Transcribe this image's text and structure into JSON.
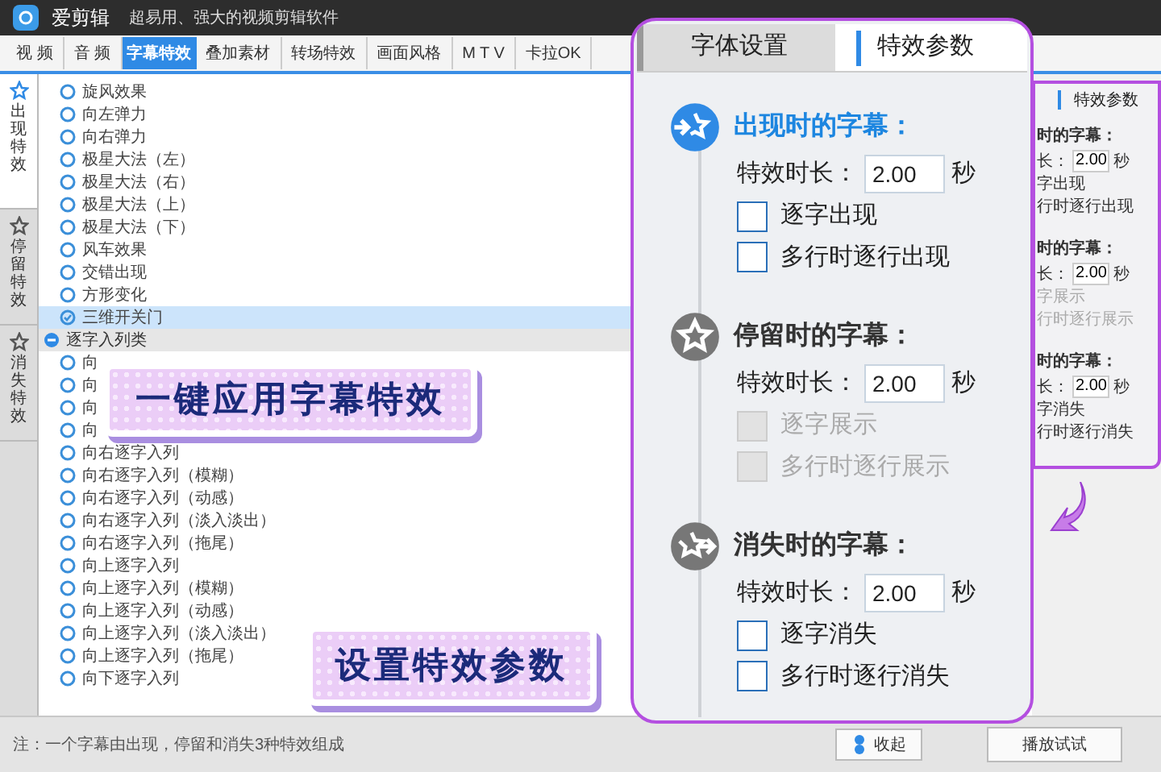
{
  "title_bar": {
    "app_name": "爱剪辑",
    "slogan": "超易用、强大的视频剪辑软件"
  },
  "tabs": [
    {
      "label": "视 频",
      "selected": false
    },
    {
      "label": "音 频",
      "selected": false
    },
    {
      "label": "字幕特效",
      "selected": true
    },
    {
      "label": "叠加素材",
      "selected": false
    },
    {
      "label": "转场特效",
      "selected": false
    },
    {
      "label": "画面风格",
      "selected": false
    },
    {
      "label": "M T V",
      "selected": false
    },
    {
      "label": "卡拉OK",
      "selected": false
    }
  ],
  "side_tabs": [
    {
      "label": "出现特效",
      "selected": true
    },
    {
      "label": "停留特效",
      "selected": false
    },
    {
      "label": "消失特效",
      "selected": false
    }
  ],
  "effect_list": [
    {
      "kind": "item",
      "label": "旋风效果",
      "selected": false
    },
    {
      "kind": "item",
      "label": "向左弹力",
      "selected": false
    },
    {
      "kind": "item",
      "label": "向右弹力",
      "selected": false
    },
    {
      "kind": "item",
      "label": "极星大法（左）",
      "selected": false
    },
    {
      "kind": "item",
      "label": "极星大法（右）",
      "selected": false
    },
    {
      "kind": "item",
      "label": "极星大法（上）",
      "selected": false
    },
    {
      "kind": "item",
      "label": "极星大法（下）",
      "selected": false
    },
    {
      "kind": "item",
      "label": "风车效果",
      "selected": false
    },
    {
      "kind": "item",
      "label": "交错出现",
      "selected": false
    },
    {
      "kind": "item",
      "label": "方形变化",
      "selected": false
    },
    {
      "kind": "item",
      "label": "三维开关门",
      "selected": true
    },
    {
      "kind": "category",
      "label": "逐字入列类",
      "expanded": true,
      "children": [
        {
          "kind": "item",
          "label": "向",
          "selected": false
        },
        {
          "kind": "item",
          "label": "向",
          "selected": false
        },
        {
          "kind": "item",
          "label": "向",
          "selected": false
        },
        {
          "kind": "item",
          "label": "向",
          "selected": false
        },
        {
          "kind": "item",
          "label": "向右逐字入列",
          "selected": false
        },
        {
          "kind": "item",
          "label": "向右逐字入列（模糊）",
          "selected": false
        },
        {
          "kind": "item",
          "label": "向右逐字入列（动感）",
          "selected": false
        },
        {
          "kind": "item",
          "label": "向右逐字入列（淡入淡出）",
          "selected": false
        },
        {
          "kind": "item",
          "label": "向右逐字入列（拖尾）",
          "selected": false
        },
        {
          "kind": "item",
          "label": "向上逐字入列",
          "selected": false
        },
        {
          "kind": "item",
          "label": "向上逐字入列（模糊）",
          "selected": false
        },
        {
          "kind": "item",
          "label": "向上逐字入列（动感）",
          "selected": false
        },
        {
          "kind": "item",
          "label": "向上逐字入列（淡入淡出）",
          "selected": false
        },
        {
          "kind": "item",
          "label": "向上逐字入列（拖尾）",
          "selected": false
        },
        {
          "kind": "item",
          "label": "向下逐字入列",
          "selected": false
        }
      ]
    }
  ],
  "background_panel": {
    "tab": "特效参数",
    "sections": [
      {
        "title": "时的字幕：",
        "duration_label": "长：",
        "duration_value": "2.00",
        "unit": "秒",
        "options": [
          {
            "label": "字出现",
            "disabled": false
          },
          {
            "label": "行时逐行出现",
            "disabled": false
          }
        ]
      },
      {
        "title": "时的字幕：",
        "duration_label": "长：",
        "duration_value": "2.00",
        "unit": "秒",
        "options": [
          {
            "label": "字展示",
            "disabled": true
          },
          {
            "label": "行时逐行展示",
            "disabled": true
          }
        ]
      },
      {
        "title": "时的字幕：",
        "duration_label": "长：",
        "duration_value": "2.00",
        "unit": "秒",
        "options": [
          {
            "label": "字消失",
            "disabled": false
          },
          {
            "label": "行时逐行消失",
            "disabled": false
          }
        ]
      }
    ]
  },
  "settings_panel": {
    "tabs": [
      {
        "label": "字体设置",
        "selected": false
      },
      {
        "label": "特效参数",
        "selected": true
      }
    ],
    "sections": [
      {
        "kind": "appear",
        "title": "出现时的字幕：",
        "active": true,
        "duration_label": "特效时长：",
        "duration_value": "2.00",
        "unit": "秒",
        "options": [
          {
            "label": "逐字出现",
            "checked": false,
            "disabled": false
          },
          {
            "label": "多行时逐行出现",
            "checked": false,
            "disabled": false
          }
        ]
      },
      {
        "kind": "stay",
        "title": "停留时的字幕：",
        "active": false,
        "duration_label": "特效时长：",
        "duration_value": "2.00",
        "unit": "秒",
        "options": [
          {
            "label": "逐字展示",
            "checked": false,
            "disabled": true
          },
          {
            "label": "多行时逐行展示",
            "checked": false,
            "disabled": true
          }
        ]
      },
      {
        "kind": "vanish",
        "title": "消失时的字幕：",
        "active": false,
        "duration_label": "特效时长：",
        "duration_value": "2.00",
        "unit": "秒",
        "options": [
          {
            "label": "逐字消失",
            "checked": false,
            "disabled": false
          },
          {
            "label": "多行时逐行消失",
            "checked": false,
            "disabled": false
          }
        ]
      }
    ]
  },
  "banners": [
    "一键应用字幕特效",
    "设置特效参数"
  ],
  "status_bar": {
    "note": "注：一个字幕由出现，停留和消失3种特效组成",
    "buttons": [
      "收起",
      "播放试试"
    ]
  }
}
